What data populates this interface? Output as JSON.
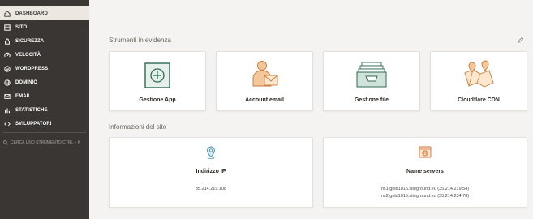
{
  "sidebar": {
    "items": [
      {
        "label": "DASHBOARD",
        "icon": "home-icon"
      },
      {
        "label": "SITO",
        "icon": "site-icon"
      },
      {
        "label": "SICUREZZA",
        "icon": "lock-icon"
      },
      {
        "label": "VELOCITÀ",
        "icon": "speed-icon"
      },
      {
        "label": "WORDPRESS",
        "icon": "wordpress-icon"
      },
      {
        "label": "DOMINIO",
        "icon": "globe-icon"
      },
      {
        "label": "EMAIL",
        "icon": "email-icon"
      },
      {
        "label": "STATISTICHE",
        "icon": "stats-icon"
      },
      {
        "label": "SVILUPPATORI",
        "icon": "code-icon"
      }
    ],
    "search_label": "CERCA UNO STRUMENTO CTRL + K"
  },
  "tools": {
    "title": "Strumenti in evidenza",
    "cards": [
      {
        "label": "Gestione App",
        "icon": "app-manager-icon"
      },
      {
        "label": "Account email",
        "icon": "email-account-icon"
      },
      {
        "label": "Gestione file",
        "icon": "file-manager-icon"
      },
      {
        "label": "Cloudflare CDN",
        "icon": "cdn-map-icon"
      }
    ]
  },
  "site_info": {
    "title": "Informazioni del sito",
    "ip": {
      "label": "Indirizzo IP",
      "value": "35.214.219.108"
    },
    "nameservers": {
      "label": "Name servers",
      "ns1": "ns1.gnld1015.siteground.eu (35.214.219.54)",
      "ns2": "ns2.gnld1015.siteground.eu (35.214.234.78)"
    }
  },
  "colors": {
    "sidebar_bg": "#3a3633",
    "accent": "#2d8a6a",
    "orange": "#e8944f"
  }
}
